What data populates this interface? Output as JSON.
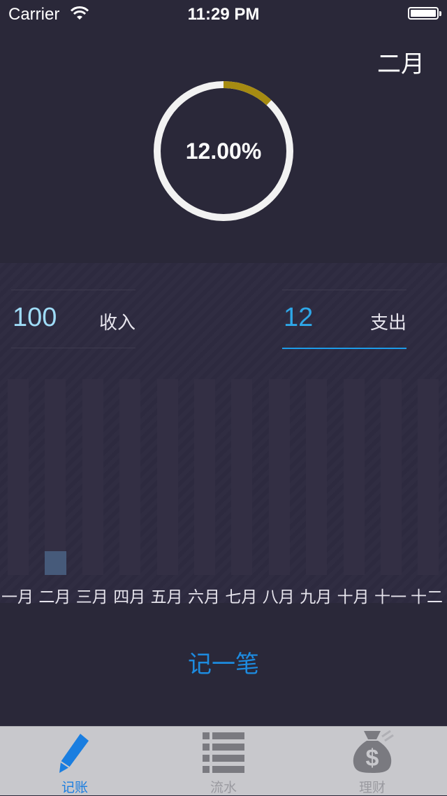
{
  "status_bar": {
    "carrier": "Carrier",
    "time": "11:29 PM"
  },
  "header": {
    "month_title": "二月"
  },
  "ring": {
    "percent_text": "12.00%",
    "progress": 0.12,
    "track_color": "#f2f2f2",
    "progress_color": "#a68b12"
  },
  "stats": {
    "income": {
      "value": "100",
      "label": "收入"
    },
    "expense": {
      "value": "12",
      "label": "支出"
    }
  },
  "chart_data": {
    "type": "bar",
    "categories": [
      "一月",
      "二月",
      "三月",
      "四月",
      "五月",
      "六月",
      "七月",
      "八月",
      "九月",
      "十月",
      "十一",
      "十二"
    ],
    "values": [
      0,
      12,
      0,
      0,
      0,
      0,
      0,
      0,
      0,
      0,
      0,
      0
    ],
    "ylim": [
      0,
      100
    ],
    "colors": {
      "track": "#332f44",
      "fill": "#465a7a"
    }
  },
  "actions": {
    "record_label": "记一笔"
  },
  "tab_bar": {
    "tabs": [
      {
        "label": "记账",
        "icon": "pencil-icon",
        "active": true
      },
      {
        "label": "流水",
        "icon": "list-icon",
        "active": false
      },
      {
        "label": "理财",
        "icon": "money-bag-icon",
        "active": false
      }
    ]
  }
}
